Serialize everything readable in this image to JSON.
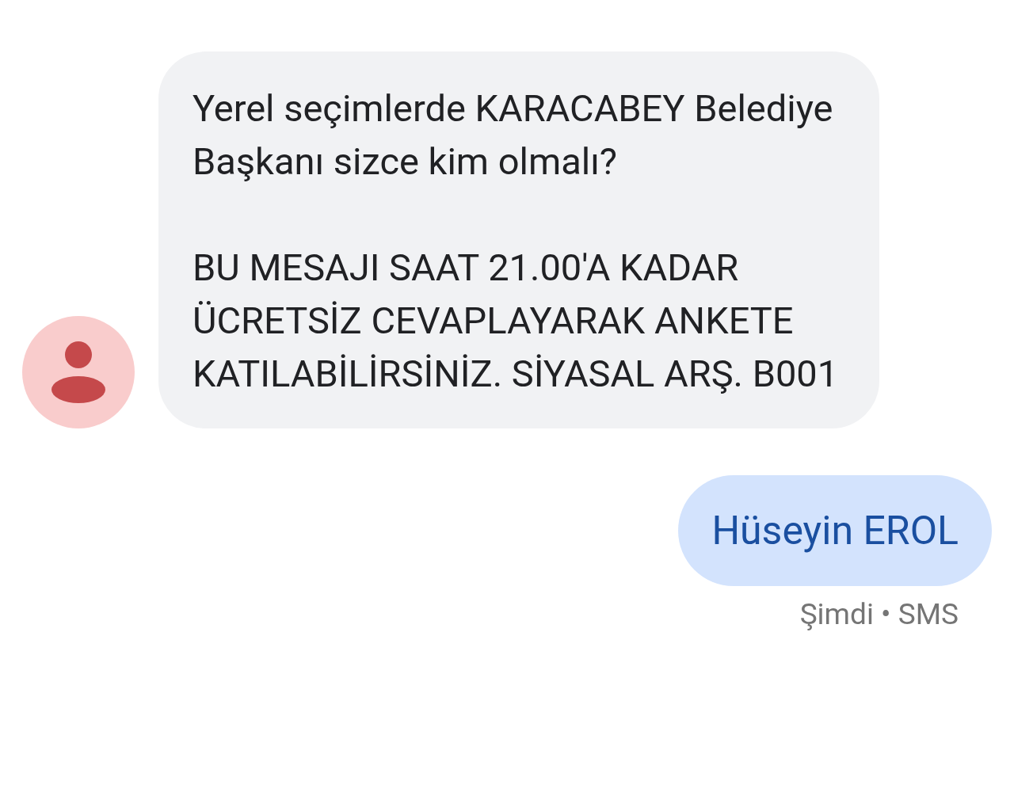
{
  "incoming": {
    "paragraphs": [
      "Yerel seçimlerde KARACABEY Belediye Başkanı sizce kim olmalı?",
      "BU MESAJI SAAT 21.00'A KADAR ÜCRETSİZ CEVAPLAYARAK ANKETE KATILABİLİRSİNİZ. SİYASAL ARŞ. B001"
    ]
  },
  "outgoing": {
    "text": "Hüseyin EROL",
    "meta": "Şimdi • SMS"
  }
}
